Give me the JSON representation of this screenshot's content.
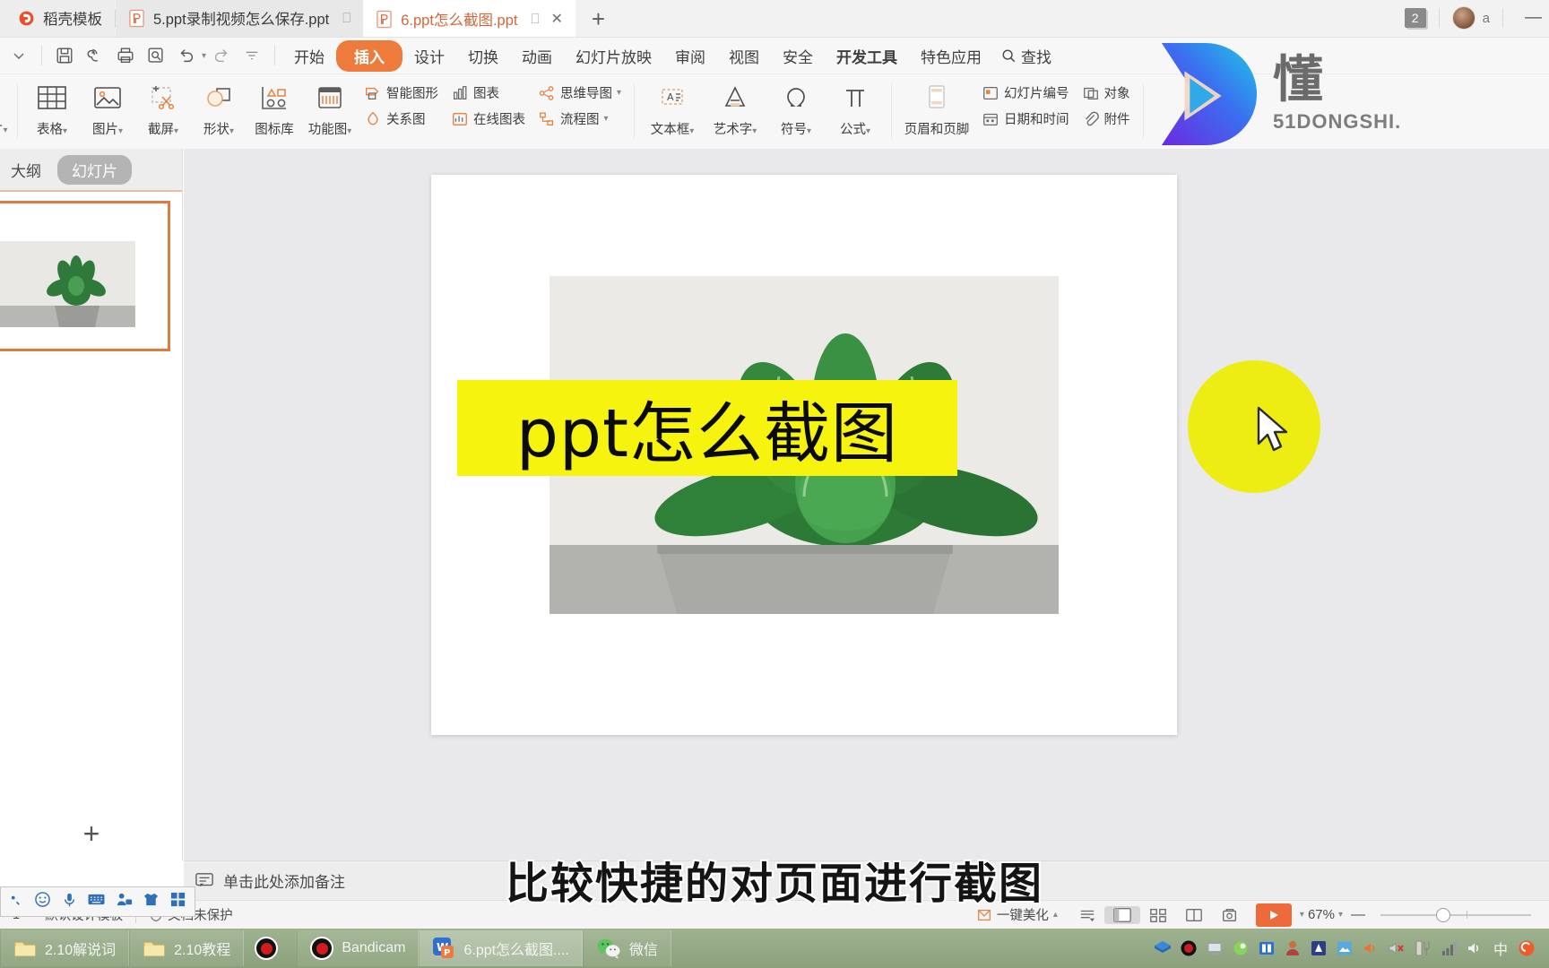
{
  "window": {
    "tabs": [
      {
        "label": "稻壳模板",
        "icon": "docer-icon",
        "state": "first"
      },
      {
        "label": "5.ppt录制视频怎么保存.ppt",
        "icon": "ppt-file-icon",
        "state": "inactive"
      },
      {
        "label": "6.ppt怎么截图.ppt",
        "icon": "ppt-file-icon",
        "state": "active"
      }
    ],
    "new_tab_label": "+",
    "badge_count": "2",
    "account_label": "a",
    "minimize_label": "—"
  },
  "quick_access": [
    {
      "name": "save-icon",
      "label": "保存"
    },
    {
      "name": "cloud-sync-icon",
      "label": "同步"
    },
    {
      "name": "print-icon",
      "label": "打印"
    },
    {
      "name": "print-preview-icon",
      "label": "打印预览"
    },
    {
      "name": "undo-icon",
      "label": "撤销"
    },
    {
      "name": "redo-icon",
      "label": "恢复"
    },
    {
      "name": "customize-icon",
      "label": "自定义快速访问工具栏"
    }
  ],
  "menu_tabs": [
    {
      "label": "开始",
      "selected": false,
      "bold": false
    },
    {
      "label": "插入",
      "selected": true,
      "bold": false
    },
    {
      "label": "设计",
      "selected": false,
      "bold": false
    },
    {
      "label": "切换",
      "selected": false,
      "bold": false
    },
    {
      "label": "动画",
      "selected": false,
      "bold": false
    },
    {
      "label": "幻灯片放映",
      "selected": false,
      "bold": false
    },
    {
      "label": "审阅",
      "selected": false,
      "bold": false
    },
    {
      "label": "视图",
      "selected": false,
      "bold": false
    },
    {
      "label": "安全",
      "selected": false,
      "bold": false
    },
    {
      "label": "开发工具",
      "selected": false,
      "bold": true
    },
    {
      "label": "特色应用",
      "selected": false,
      "bold": false
    }
  ],
  "find": {
    "label": "查找",
    "icon": "search-icon"
  },
  "ribbon": {
    "big_buttons": [
      {
        "label": "表格",
        "icon": "table-icon",
        "dropdown": true
      },
      {
        "label": "图片",
        "icon": "picture-icon",
        "dropdown": true
      },
      {
        "label": "截屏",
        "icon": "screenshot-icon",
        "dropdown": true
      },
      {
        "label": "形状",
        "icon": "shapes-icon",
        "dropdown": true
      },
      {
        "label": "图标库",
        "icon": "icon-library-icon",
        "dropdown": false
      },
      {
        "label": "功能图",
        "icon": "function-chart-icon",
        "dropdown": true
      }
    ],
    "group_charts": [
      {
        "label": "智能图形",
        "icon": "smartart-icon",
        "dropdown": false
      },
      {
        "label": "关系图",
        "icon": "relation-chart-icon",
        "dropdown": false
      }
    ],
    "group_charts2": [
      {
        "label": "图表",
        "icon": "chart-icon",
        "dropdown": false
      },
      {
        "label": "在线图表",
        "icon": "online-chart-icon",
        "dropdown": false
      }
    ],
    "group_mind": [
      {
        "label": "思维导图",
        "icon": "mindmap-icon",
        "dropdown": true
      },
      {
        "label": "流程图",
        "icon": "flowchart-icon",
        "dropdown": true
      }
    ],
    "big_buttons2": [
      {
        "label": "文本框",
        "icon": "textbox-icon",
        "dropdown": true
      },
      {
        "label": "艺术字",
        "icon": "wordart-icon",
        "dropdown": true
      },
      {
        "label": "符号",
        "icon": "symbol-icon",
        "dropdown": true
      },
      {
        "label": "公式",
        "icon": "formula-icon",
        "dropdown": true
      }
    ],
    "header_footer": {
      "label": "页眉和页脚",
      "icon": "header-footer-icon"
    },
    "group_object": [
      {
        "label": "幻灯片编号",
        "icon": "slide-number-icon"
      },
      {
        "label": "对象",
        "icon": "object-icon"
      }
    ],
    "group_object2": [
      {
        "label": "日期和时间",
        "icon": "date-time-icon"
      },
      {
        "label": "附件",
        "icon": "attachment-icon"
      }
    ]
  },
  "left_pane": {
    "tabs": [
      {
        "label": "大纲",
        "selected": false
      },
      {
        "label": "幻灯片",
        "selected": true
      }
    ],
    "add_slide_label": "+"
  },
  "slide": {
    "title_text": "ppt怎么截图",
    "highlight_color": "#f6f40e",
    "text_color": "#0b0b0b"
  },
  "notes": {
    "placeholder": "单击此处添加备注",
    "icon": "note-icon"
  },
  "status_bar": {
    "slide_index": "1",
    "template_label": "默认设计模板",
    "protection_label": "文档未保护",
    "beautify_label": "一键美化",
    "views": [
      {
        "name": "normal-view-icon"
      },
      {
        "name": "slide-sorter-icon"
      },
      {
        "name": "reading-view-icon"
      },
      {
        "name": "notes-view-icon"
      }
    ],
    "play_label": "▶",
    "zoom_label": "67%",
    "zoom_minus": "—"
  },
  "subtitle": {
    "text": "比较快捷的对页面进行截图"
  },
  "watermark": {
    "brand_cn": "懂",
    "brand_en": "51DONGSHI.",
    "gradient_start": "#6b2ae0",
    "gradient_end": "#1fc8e8"
  },
  "taskbar": {
    "items": [
      {
        "label": "2.10解说词",
        "icon": "folder-icon",
        "selected": false
      },
      {
        "label": "2.10教程",
        "icon": "folder-icon",
        "selected": false
      },
      {
        "label": "",
        "icon": "record-icon",
        "selected": false
      },
      {
        "label": "Bandicam",
        "icon": "record-icon",
        "selected": false
      },
      {
        "label": "6.ppt怎么截图....",
        "icon": "wps-ppt-icon",
        "selected": true
      },
      {
        "label": "微信",
        "icon": "wechat-icon",
        "selected": false
      }
    ],
    "tray": [
      {
        "name": "tray-blue-layers-icon"
      },
      {
        "name": "tray-bandicam-icon"
      },
      {
        "name": "tray-screen-icon"
      },
      {
        "name": "tray-green-icon"
      },
      {
        "name": "tray-book-icon"
      },
      {
        "name": "tray-person-icon"
      },
      {
        "name": "tray-app-icon"
      },
      {
        "name": "tray-cloud-icon"
      },
      {
        "name": "tray-volume-icon"
      },
      {
        "name": "tray-muted-icon"
      },
      {
        "name": "tray-tool-icon"
      },
      {
        "name": "tray-signal-icon"
      },
      {
        "name": "tray-speaker-icon"
      },
      {
        "name": "tray-ime-icon"
      },
      {
        "name": "tray-sogou-icon"
      }
    ],
    "ime_label": "中"
  },
  "ime_bar": {
    "icons": [
      {
        "name": "ime-logo-icon"
      },
      {
        "name": "ime-emoji-icon"
      },
      {
        "name": "ime-voice-icon"
      },
      {
        "name": "ime-keyboard-icon"
      },
      {
        "name": "ime-user-icon"
      },
      {
        "name": "ime-skin-icon"
      },
      {
        "name": "ime-apps-icon"
      }
    ]
  }
}
